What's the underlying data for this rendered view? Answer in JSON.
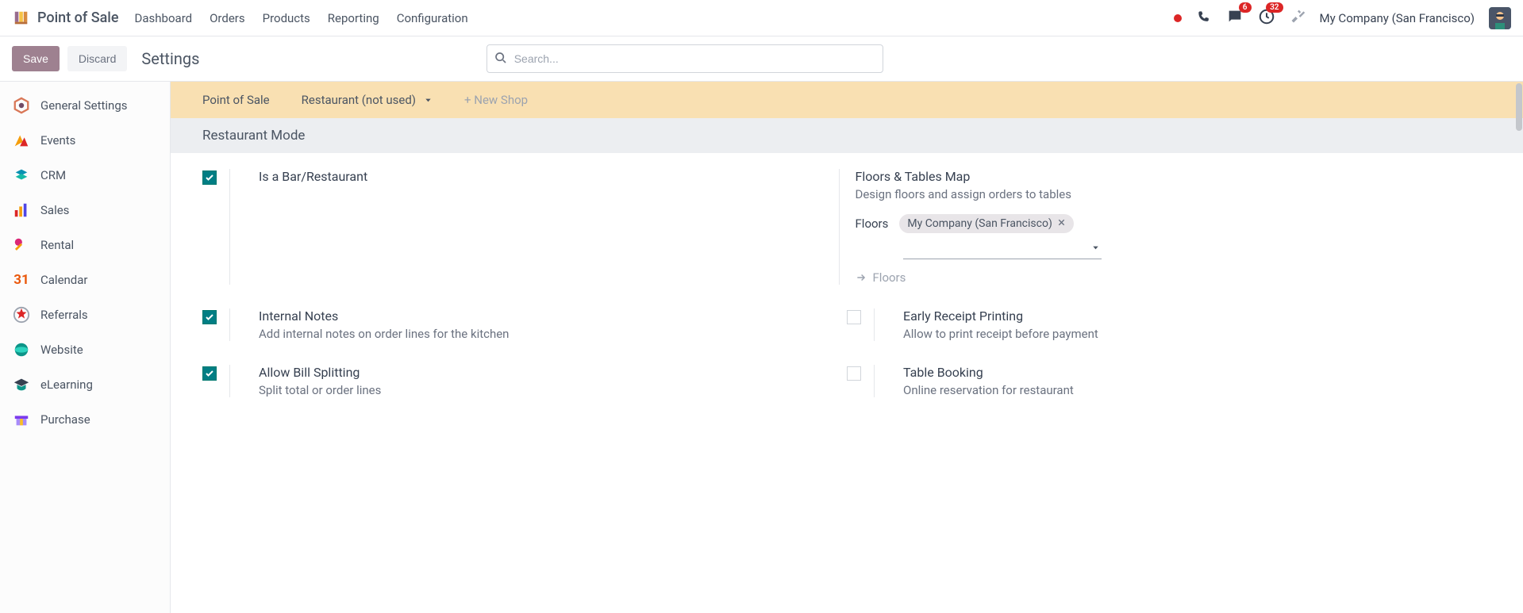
{
  "topnav": {
    "brand": "Point of Sale",
    "links": [
      "Dashboard",
      "Orders",
      "Products",
      "Reporting",
      "Configuration"
    ],
    "msg_badge": "6",
    "activity_badge": "32",
    "company": "My Company (San Francisco)"
  },
  "actions": {
    "save": "Save",
    "discard": "Discard",
    "title": "Settings",
    "search_placeholder": "Search..."
  },
  "sidebar": {
    "items": [
      {
        "label": "General Settings",
        "icon": "hex"
      },
      {
        "label": "Events",
        "icon": "events"
      },
      {
        "label": "CRM",
        "icon": "crm"
      },
      {
        "label": "Sales",
        "icon": "sales"
      },
      {
        "label": "Rental",
        "icon": "rental"
      },
      {
        "label": "Calendar",
        "icon": "calendar"
      },
      {
        "label": "Referrals",
        "icon": "referrals"
      },
      {
        "label": "Website",
        "icon": "website"
      },
      {
        "label": "eLearning",
        "icon": "elearning"
      },
      {
        "label": "Purchase",
        "icon": "purchase"
      }
    ]
  },
  "posbar": {
    "label": "Point of Sale",
    "selected": "Restaurant (not used)",
    "new": "+ New Shop"
  },
  "section": {
    "title": "Restaurant Mode"
  },
  "settings": {
    "is_bar": {
      "label": "Is a Bar/Restaurant"
    },
    "floors_map": {
      "label": "Floors & Tables Map",
      "desc": "Design floors and assign orders to tables",
      "floors_label": "Floors",
      "floors_tag": "My Company (San Francisco)",
      "floors_link": "Floors"
    },
    "internal_notes": {
      "label": "Internal Notes",
      "desc": "Add internal notes on order lines for the kitchen"
    },
    "early_receipt": {
      "label": "Early Receipt Printing",
      "desc": "Allow to print receipt before payment"
    },
    "bill_split": {
      "label": "Allow Bill Splitting",
      "desc": "Split total or order lines"
    },
    "table_booking": {
      "label": "Table Booking",
      "desc": "Online reservation for restaurant"
    }
  }
}
